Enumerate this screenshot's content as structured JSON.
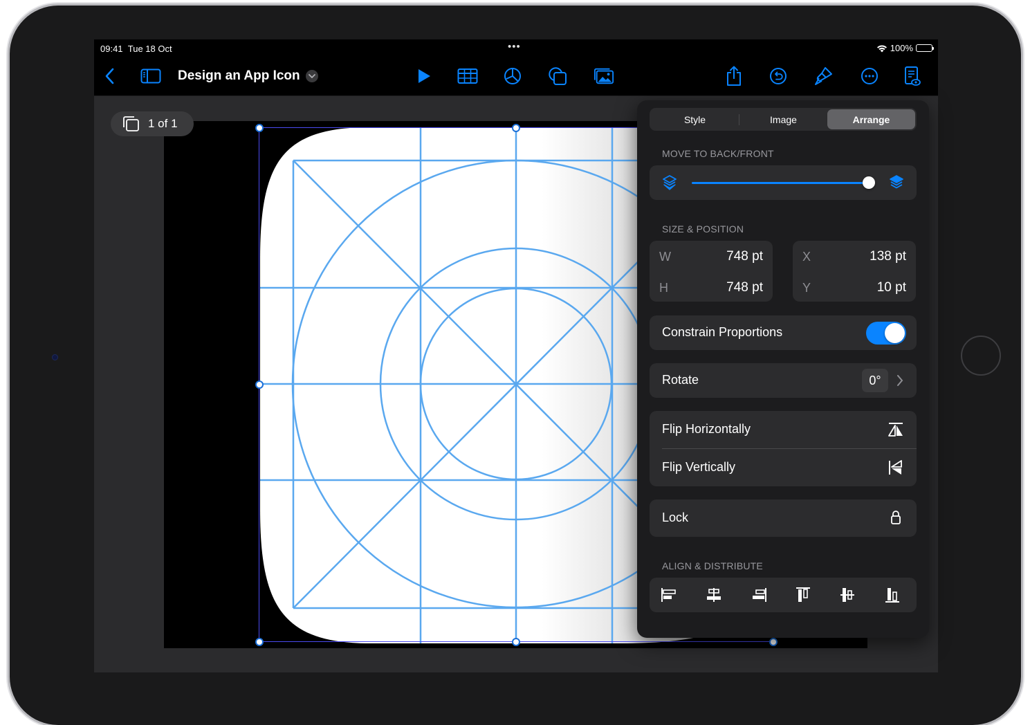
{
  "status_bar": {
    "time": "09:41",
    "date": "Tue 18 Oct",
    "battery": "100%",
    "multitask_dots": "•••"
  },
  "toolbar": {
    "document_title": "Design an App Icon",
    "icons": {
      "back": "chevron-left-icon",
      "sidebar": "sidebar-icon",
      "play": "play-icon",
      "table": "table-icon",
      "chart": "chart-icon",
      "shape": "shape-icon",
      "media": "media-icon",
      "share": "share-icon",
      "undo": "undo-icon",
      "format": "paintbrush-icon",
      "more": "ellipsis-icon",
      "presenter": "presenter-notes-icon"
    },
    "accent_color": "#0a84ff"
  },
  "canvas": {
    "slide_counter": "1 of 1"
  },
  "format_panel": {
    "tabs": [
      {
        "label": "Style",
        "active": false
      },
      {
        "label": "Image",
        "active": false
      },
      {
        "label": "Arrange",
        "active": true
      }
    ],
    "move_section": {
      "label": "MOVE TO BACK/FRONT",
      "slider_value": 1.0
    },
    "size_section": {
      "label": "SIZE & POSITION",
      "w_key": "W",
      "w_value": "748 pt",
      "h_key": "H",
      "h_value": "748 pt",
      "x_key": "X",
      "x_value": "138 pt",
      "y_key": "Y",
      "y_value": "10 pt"
    },
    "constrain": {
      "label": "Constrain Proportions",
      "on": true
    },
    "rotate": {
      "label": "Rotate",
      "value": "0°"
    },
    "flip_horizontal": "Flip Horizontally",
    "flip_vertical": "Flip Vertically",
    "lock": "Lock",
    "align_section": {
      "label": "ALIGN & DISTRIBUTE",
      "buttons": [
        "align-left-icon",
        "align-center-icon",
        "align-right-icon",
        "align-top-icon",
        "align-middle-icon",
        "align-bottom-icon"
      ]
    }
  }
}
